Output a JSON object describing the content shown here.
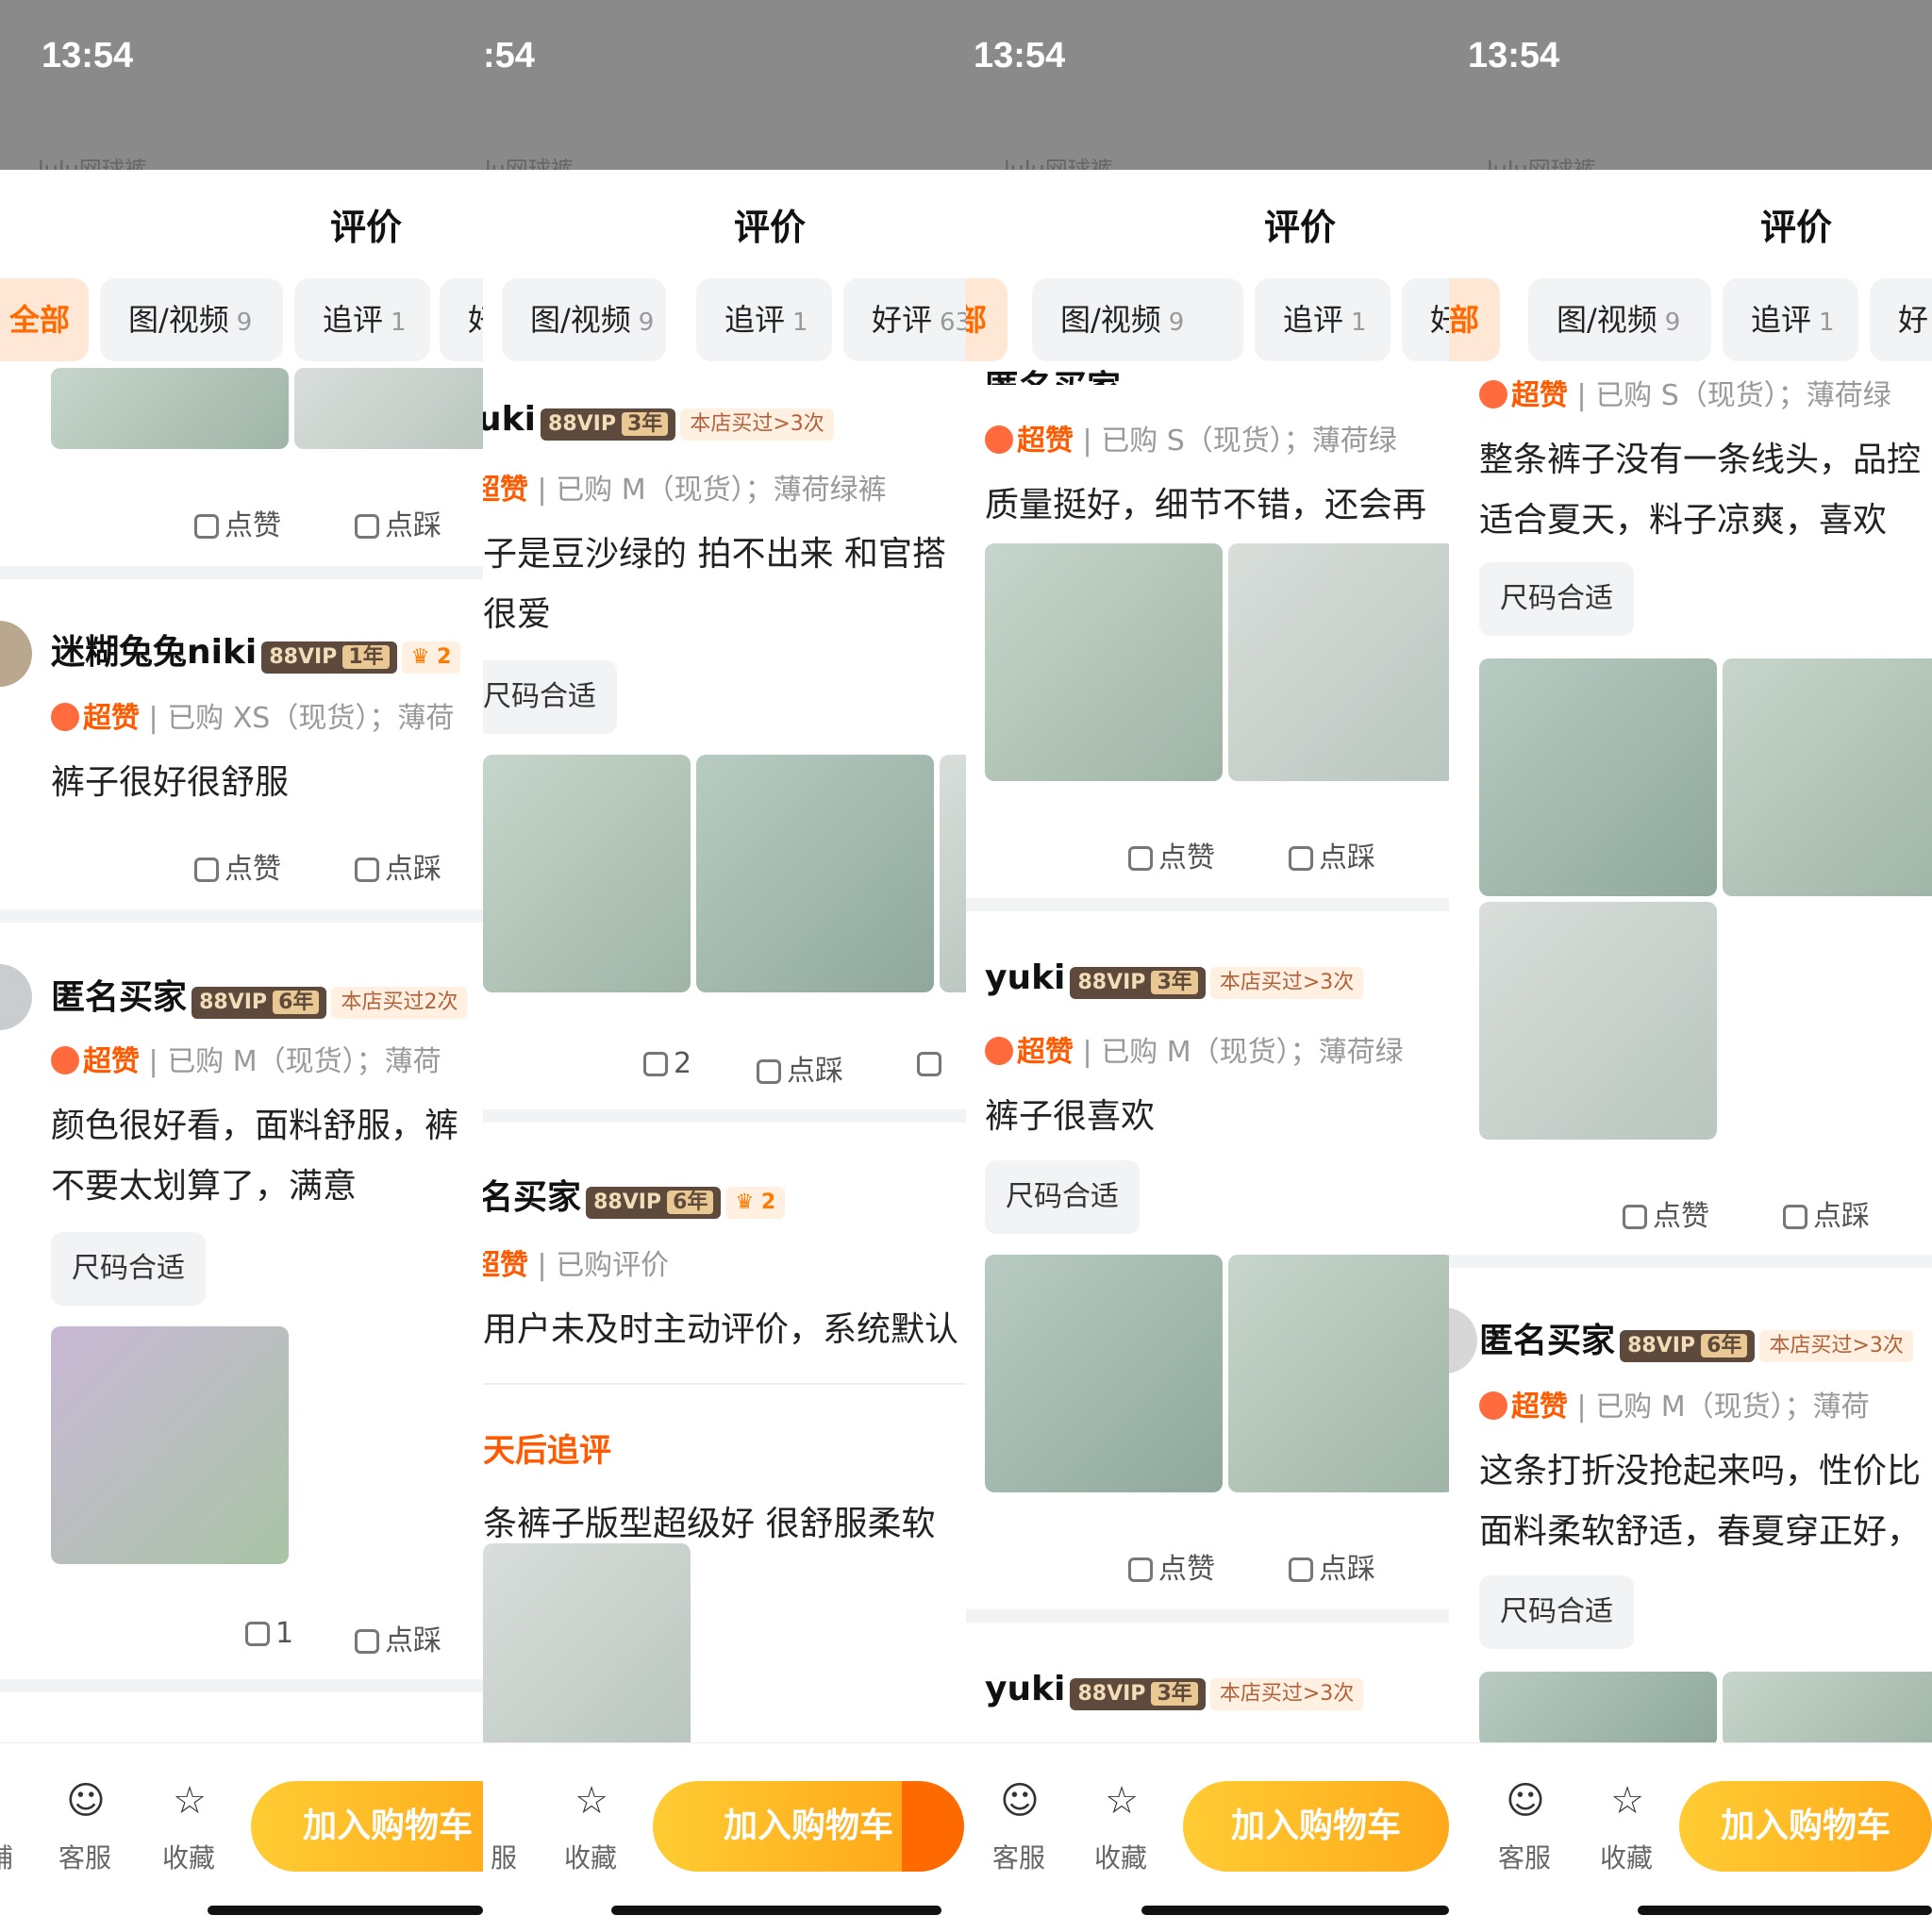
{
  "time": "13:54",
  "time_cut": ":54",
  "search_ghost": "lulu网球裤",
  "sheet_title": "评价",
  "tabs": {
    "all": "全部",
    "all_cut": "部",
    "media": "图/视频",
    "media_count": "9",
    "follow": "追评",
    "follow_count": "1",
    "good": "好评",
    "good_count": "63",
    "good_cut": "好",
    "good_cut2": "好评"
  },
  "common": {
    "like": "点赞",
    "dislike": "点踩",
    "size_ok": "尺码合适",
    "super": "超赞",
    "add_cart": "加入购物车",
    "service": "客服",
    "favorite": "收藏",
    "shop_cut": "铺",
    "service_cut": "服"
  },
  "panel1": {
    "r1": {
      "name": "迷糊兔兔niki",
      "vip": "88VIP",
      "years": "1年",
      "crown": "2",
      "purchase": "已购 XS（现货）；薄荷",
      "text": "裤子很好很舒服"
    },
    "r2": {
      "name": "匿名买家",
      "vip": "88VIP",
      "years": "6年",
      "shop": "本店买过2次",
      "purchase": "已购 M（现货）；薄荷",
      "text1": "颜色很好看，面料舒服，裤",
      "text2": "不要太划算了，满意",
      "likes": "1"
    }
  },
  "panel2": {
    "r1": {
      "name": "uki",
      "vip": "88VIP",
      "years": "3年",
      "shop": "本店买过>3次",
      "purchase": "已购 M（现货）；薄荷绿裤",
      "text1": "子是豆沙绿的 拍不出来 和官搭",
      "text2": "很爱",
      "likes": "2"
    },
    "r2": {
      "name": "名买家",
      "vip": "88VIP",
      "years": "6年",
      "crown": "2",
      "purchase": "已购评价",
      "text": "用户未及时主动评价，系统默认",
      "follow_title": "天后追评",
      "follow_text": "条裤子版型超级好 很舒服柔软"
    }
  },
  "panel3": {
    "r0": {
      "name": "匿名买家",
      "purchase": "已购 S（现货）；薄荷绿",
      "text": "质量挺好，细节不错，还会再"
    },
    "r1": {
      "name": "yuki",
      "vip": "88VIP",
      "years": "3年",
      "shop": "本店买过>3次",
      "purchase": "已购 M（现货）；薄荷绿",
      "text": "裤子很喜欢"
    },
    "r2": {
      "name": "yuki",
      "vip": "88VIP",
      "years": "3年",
      "shop": "本店买过>3次"
    }
  },
  "panel4": {
    "r0": {
      "purchase": "已购 S（现货）；薄荷绿",
      "text1": "整条裤子没有一条线头，品控",
      "text2": "适合夏天，料子凉爽，喜欢"
    },
    "r1": {
      "name": "匿名买家",
      "vip": "88VIP",
      "years": "6年",
      "shop": "本店买过>3次",
      "purchase": "已购 M（现货）；薄荷",
      "text1": "这条打折没抢起来吗，性价比",
      "text2": "面料柔软舒适，春夏穿正好，"
    }
  }
}
